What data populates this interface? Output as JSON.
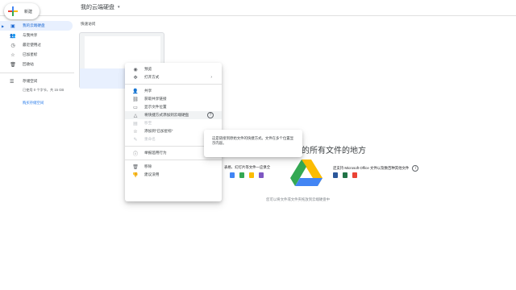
{
  "header": {
    "new_label": "新建",
    "title": "我的云端硬盘",
    "title_caret": "▾"
  },
  "sidebar": {
    "items": [
      {
        "label": "我的云端硬盘",
        "icon": "drive-icon",
        "active": true
      },
      {
        "label": "与我共享",
        "icon": "shared-icon",
        "active": false
      },
      {
        "label": "最近使用过",
        "icon": "clock-icon",
        "active": false
      },
      {
        "label": "已加星标",
        "icon": "star-icon",
        "active": false
      },
      {
        "label": "回收站",
        "icon": "trash-icon",
        "active": false
      }
    ],
    "storage_label": "存储空间",
    "storage_used": "已使用 0 个字节，共 15 GB",
    "buy_storage": "购买存储空间"
  },
  "main": {
    "quick_access": "快速访问",
    "empty_title": "的所有文件的地方",
    "feature_left": "表格、幻灯片等文件一应俱全",
    "feature_right": "还支持 Microsoft Office 文件以及数百种其他文件",
    "upload_hint": "您可以将文件或文件夹拖放到云端硬盘中"
  },
  "context_menu": {
    "items": [
      {
        "label": "预览",
        "icon": "eye-icon",
        "disabled": false
      },
      {
        "label": "打开方式",
        "icon": "open-with-icon",
        "disabled": false,
        "submenu": "›"
      },
      {
        "label": "共享",
        "icon": "share-person-icon",
        "disabled": false
      },
      {
        "label": "获取共享链接",
        "icon": "link-icon",
        "disabled": false
      },
      {
        "label": "显示文件位置",
        "icon": "folder-icon",
        "disabled": false
      },
      {
        "label": "将快捷方式添加到云端硬盘",
        "icon": "shortcut-drive-icon",
        "disabled": false,
        "help": "?"
      },
      {
        "label": "移至",
        "icon": "move-icon",
        "disabled": true
      },
      {
        "label": "添加到\"已加星标\"",
        "icon": "star-icon",
        "disabled": false
      },
      {
        "label": "重命名",
        "icon": "pencil-icon",
        "disabled": true
      },
      {
        "label": "举报滥用行为",
        "icon": "report-icon",
        "disabled": false
      },
      {
        "label": "移除",
        "icon": "trash-icon",
        "disabled": false
      },
      {
        "label": "建议没用",
        "icon": "thumb-down-icon",
        "disabled": false
      }
    ]
  },
  "tooltip": {
    "text": "这是链接到原始文件的快捷方式。文件在多个位置显示内容。"
  },
  "colors": {
    "accent": "#1a73e8",
    "active_bg": "#e8f0fe",
    "docs_blue": "#4285f4",
    "sheets_green": "#34a853",
    "slides_yellow": "#fbbc04",
    "red": "#ea4335"
  }
}
